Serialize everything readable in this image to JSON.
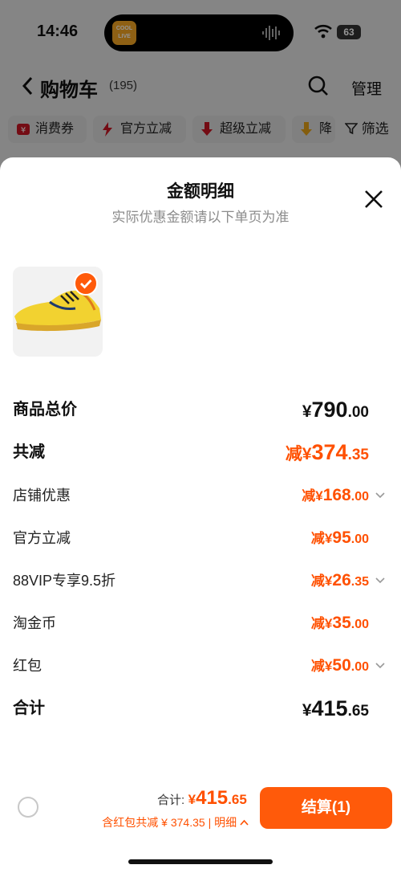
{
  "status_bar": {
    "time": "14:46",
    "battery": "63",
    "app_badge": "COOL LIVE"
  },
  "nav": {
    "title": "购物车",
    "count": "(195)",
    "manage": "管理"
  },
  "filters": [
    {
      "label": "消费券",
      "icon": "coupon-icon"
    },
    {
      "label": "官方立减",
      "icon": "lightning-icon"
    },
    {
      "label": "超级立减",
      "icon": "down-arrow-icon"
    },
    {
      "label": "降",
      "icon": "down-arrow-icon"
    }
  ],
  "filter_button": "筛选",
  "sheet": {
    "title": "金额明细",
    "subtitle": "实际优惠金额请以下单页为准"
  },
  "breakdown": {
    "total_price": {
      "label": "商品总价",
      "currency": "¥",
      "int": "790",
      "dec": ".00"
    },
    "total_discount": {
      "label": "共减",
      "prefix": "减¥",
      "int": "374",
      "dec": ".35"
    },
    "items": [
      {
        "label": "店铺优惠",
        "prefix": "减¥",
        "int": "168",
        "dec": ".00",
        "expandable": true
      },
      {
        "label": "官方立减",
        "prefix": "减¥",
        "int": "95",
        "dec": ".00",
        "expandable": false
      },
      {
        "label": "88VIP专享9.5折",
        "prefix": "减¥",
        "int": "26",
        "dec": ".35",
        "expandable": true
      },
      {
        "label": "淘金币",
        "prefix": "减¥",
        "int": "35",
        "dec": ".00",
        "expandable": false
      },
      {
        "label": "红包",
        "prefix": "减¥",
        "int": "50",
        "dec": ".00",
        "expandable": true
      }
    ],
    "grand_total": {
      "label": "合计",
      "currency": "¥",
      "int": "415",
      "dec": ".65"
    }
  },
  "bottom_bar": {
    "sum_label": "合计:",
    "sum_currency": "¥",
    "sum_int": "415",
    "sum_dec": ".65",
    "discount_note": "含红包共减 ¥ 374.35 | ",
    "detail_link": "明细",
    "checkout": "结算(1)"
  },
  "colors": {
    "accent": "#ff5000",
    "button": "#ff5a0a"
  }
}
